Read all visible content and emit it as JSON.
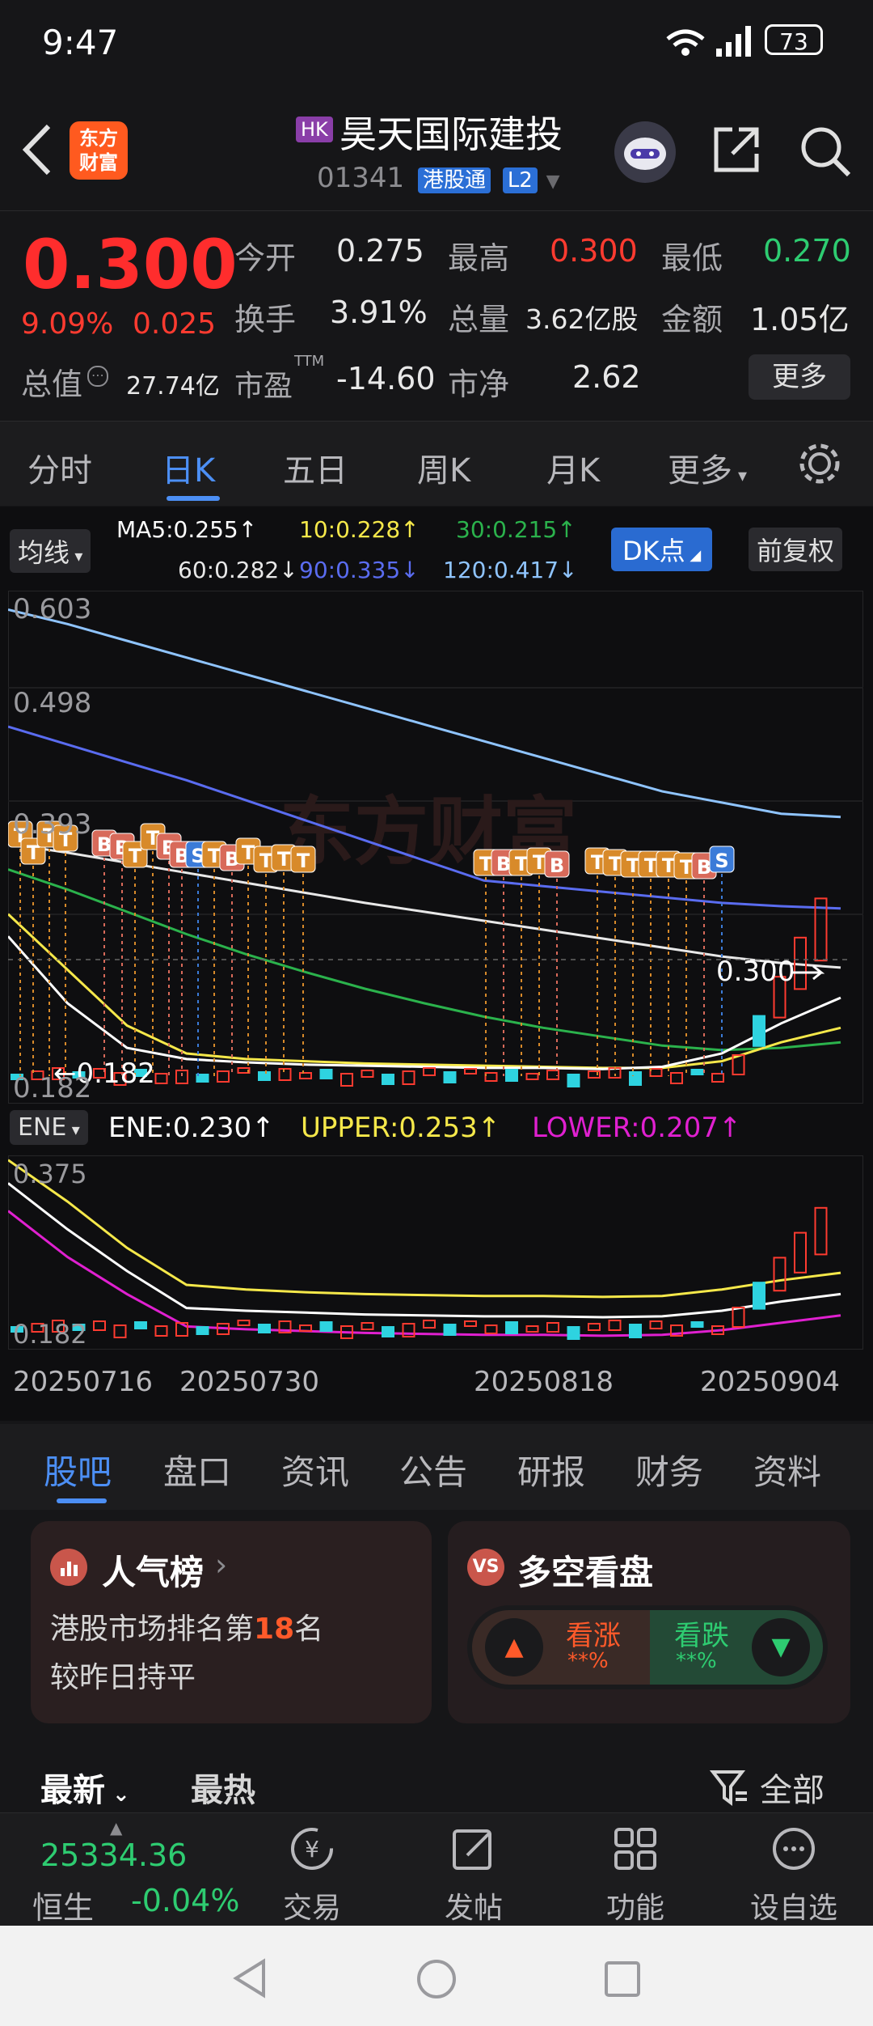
{
  "status": {
    "time": "9:47",
    "battery": "73"
  },
  "header": {
    "badge": "HK",
    "title": "昊天国际建投",
    "code": "01341",
    "tag1": "港股通",
    "tag2": "L2",
    "logo_line1": "东方",
    "logo_line2": "财富"
  },
  "quote": {
    "price": "0.300",
    "pct": "9.09%",
    "change": "0.025",
    "open_label": "今开",
    "open": "0.275",
    "high_label": "最高",
    "high": "0.300",
    "low_label": "最低",
    "low": "0.270",
    "turnover_label": "换手",
    "turnover": "3.91%",
    "volume_label": "总量",
    "volume": "3.62亿股",
    "amount_label": "金额",
    "amount": "1.05亿",
    "mktcap_label": "总值",
    "mktcap": "27.74亿",
    "pe_label": "市盈",
    "pe_sup": "TTM",
    "pe": "-14.60",
    "pb_label": "市净",
    "pb": "2.62",
    "more": "更多"
  },
  "period_tabs": [
    "分时",
    "日K",
    "五日",
    "周K",
    "月K",
    "更多"
  ],
  "ma": {
    "selector": "均线",
    "ma5": "MA5:0.255↑",
    "ma10": "10:0.228↑",
    "ma30": "30:0.215↑",
    "ma60": "60:0.282↓",
    "ma90": "90:0.335↓",
    "ma120": "120:0.417↓",
    "dk": "DK点",
    "adjust": "前复权"
  },
  "chart_data": [
    {
      "type": "line",
      "name": "main-kline",
      "y_ticks": [
        "0.603",
        "0.498",
        "0.393",
        "0.182"
      ],
      "ylim": [
        0.16,
        0.62
      ],
      "current_label": "0.300",
      "low_label": "0.182",
      "series": [
        {
          "name": "MA120",
          "color": "#8fc4ff",
          "values": [
            0.603,
            0.59,
            0.575,
            0.56,
            0.545,
            0.53,
            0.515,
            0.5,
            0.485,
            0.47,
            0.455,
            0.44,
            0.43,
            0.42,
            0.417
          ]
        },
        {
          "name": "MA90",
          "color": "#5a6cf0",
          "values": [
            0.498,
            0.482,
            0.466,
            0.45,
            0.432,
            0.414,
            0.396,
            0.378,
            0.36,
            0.355,
            0.35,
            0.345,
            0.34,
            0.337,
            0.335
          ]
        },
        {
          "name": "MA60",
          "color": "#e8e8e8",
          "values": [
            0.393,
            0.385,
            0.376,
            0.367,
            0.358,
            0.349,
            0.34,
            0.332,
            0.324,
            0.316,
            0.308,
            0.3,
            0.292,
            0.286,
            0.282
          ]
        },
        {
          "name": "MA30",
          "color": "#2bb24c",
          "values": [
            0.37,
            0.352,
            0.332,
            0.312,
            0.294,
            0.278,
            0.263,
            0.25,
            0.238,
            0.228,
            0.22,
            0.212,
            0.208,
            0.21,
            0.215
          ]
        },
        {
          "name": "MA10",
          "color": "#f5e84a",
          "values": [
            0.33,
            0.28,
            0.23,
            0.205,
            0.2,
            0.198,
            0.196,
            0.195,
            0.194,
            0.193,
            0.192,
            0.192,
            0.198,
            0.215,
            0.228
          ]
        },
        {
          "name": "MA5",
          "color": "#ffffff",
          "values": [
            0.31,
            0.25,
            0.21,
            0.2,
            0.197,
            0.195,
            0.194,
            0.193,
            0.192,
            0.192,
            0.191,
            0.193,
            0.205,
            0.232,
            0.255
          ]
        }
      ]
    },
    {
      "type": "line",
      "name": "ENE",
      "y_ticks": [
        "0.375",
        "0.182"
      ],
      "ylim": [
        0.17,
        0.38
      ],
      "series": [
        {
          "name": "UPPER",
          "color": "#f5e84a",
          "values": [
            0.375,
            0.33,
            0.28,
            0.24,
            0.235,
            0.232,
            0.23,
            0.229,
            0.228,
            0.228,
            0.227,
            0.228,
            0.235,
            0.245,
            0.253
          ]
        },
        {
          "name": "ENE",
          "color": "#ffffff",
          "values": [
            0.35,
            0.3,
            0.255,
            0.215,
            0.212,
            0.21,
            0.208,
            0.207,
            0.206,
            0.206,
            0.205,
            0.206,
            0.212,
            0.222,
            0.23
          ]
        },
        {
          "name": "LOWER",
          "color": "#e020d0",
          "values": [
            0.32,
            0.27,
            0.23,
            0.195,
            0.192,
            0.19,
            0.188,
            0.187,
            0.186,
            0.186,
            0.185,
            0.186,
            0.191,
            0.199,
            0.207
          ]
        }
      ]
    }
  ],
  "ene": {
    "selector": "ENE",
    "ene": "ENE:0.230↑",
    "upper": "UPPER:0.253↑",
    "lower": "LOWER:0.207↑"
  },
  "dates": [
    "20250716",
    "20250730",
    "20250818",
    "20250904"
  ],
  "watermark": "东方财富",
  "section_tabs": [
    "股吧",
    "盘口",
    "资讯",
    "公告",
    "研报",
    "财务",
    "资料"
  ],
  "popularity": {
    "title": "人气榜",
    "line1_pre": "港股市场排名第",
    "rank": "18",
    "line1_post": "名",
    "line2": "较昨日持平"
  },
  "vote": {
    "title": "多空看盘",
    "up_label": "看涨",
    "up_pct": "**%",
    "down_label": "看跌",
    "down_pct": "**%"
  },
  "feed_tabs": {
    "latest": "最新",
    "hot": "最热",
    "filter": "全部"
  },
  "bottom_nav": {
    "index_value": "25334.36",
    "index_name": "恒生",
    "index_change": "-0.04%",
    "items": [
      "交易",
      "发帖",
      "功能",
      "设自选"
    ]
  }
}
